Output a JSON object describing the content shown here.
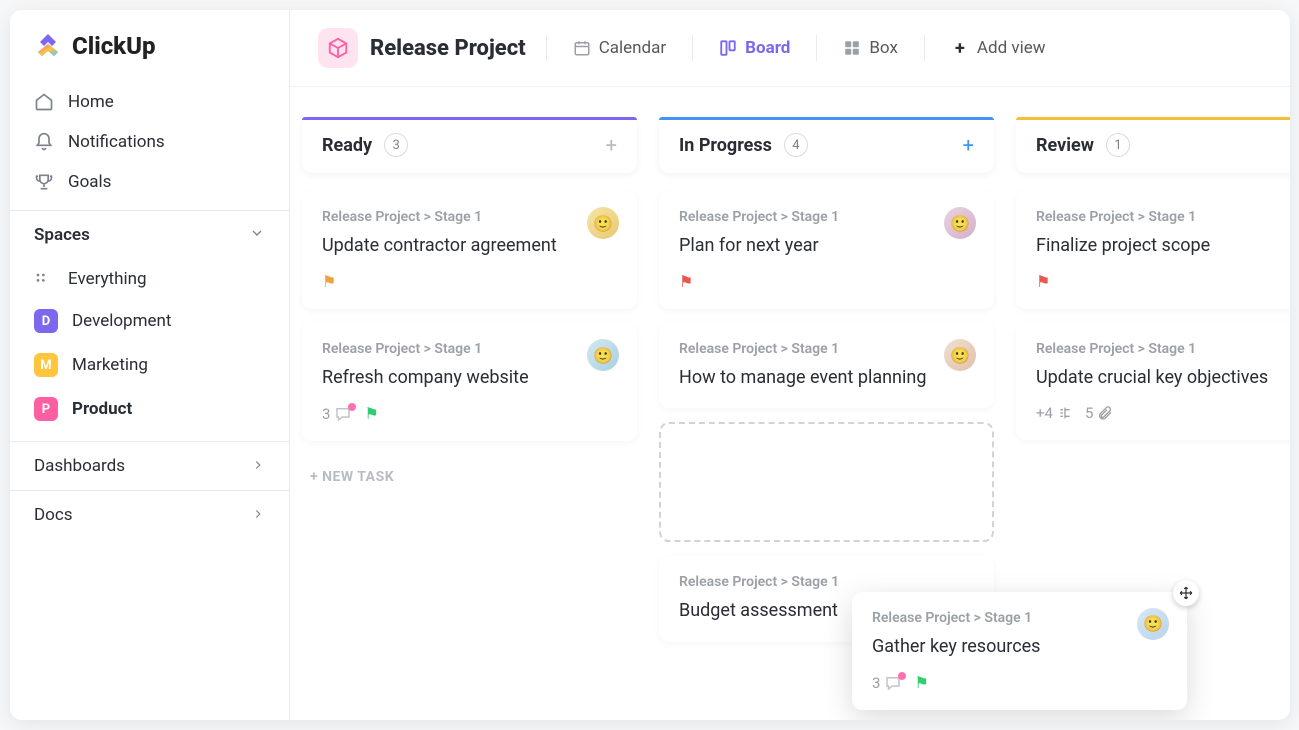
{
  "app_name": "ClickUp",
  "sidebar": {
    "nav": [
      {
        "icon": "home",
        "label": "Home"
      },
      {
        "icon": "bell",
        "label": "Notifications"
      },
      {
        "icon": "trophy",
        "label": "Goals"
      }
    ],
    "spaces_title": "Spaces",
    "everything_label": "Everything",
    "spaces": [
      {
        "letter": "D",
        "color": "#7b68ee",
        "label": "Development",
        "active": false
      },
      {
        "letter": "M",
        "color": "#ffc53d",
        "label": "Marketing",
        "active": false
      },
      {
        "letter": "P",
        "color": "#fd5fa3",
        "label": "Product",
        "active": true
      }
    ],
    "bottom": [
      {
        "label": "Dashboards"
      },
      {
        "label": "Docs"
      }
    ]
  },
  "header": {
    "project_title": "Release Project",
    "views": [
      {
        "icon": "calendar",
        "label": "Calendar",
        "active": false
      },
      {
        "icon": "board",
        "label": "Board",
        "active": true
      },
      {
        "icon": "box",
        "label": "Box",
        "active": false
      }
    ],
    "add_view_label": "Add view"
  },
  "board": {
    "breadcrumb": "Release Project > Stage 1",
    "new_task_label": "+ NEW TASK",
    "columns": [
      {
        "id": "ready",
        "title": "Ready",
        "count": "3",
        "add_color": "gray",
        "cards": [
          {
            "title": "Update contractor agreement",
            "avatar": "a",
            "flag": "orange"
          },
          {
            "title": "Refresh company website",
            "avatar": "c",
            "comments": "3",
            "flag": "green"
          }
        ]
      },
      {
        "id": "progress",
        "title": "In Progress",
        "count": "4",
        "add_color": "blue",
        "cards": [
          {
            "title": "Plan for next year",
            "avatar": "b",
            "flag": "red"
          },
          {
            "title": "How to manage event planning",
            "avatar": "d"
          }
        ],
        "has_dropzone": true,
        "extra_card": {
          "title": "Budget assessment"
        }
      },
      {
        "id": "review",
        "title": "Review",
        "count": "1",
        "cards": [
          {
            "title": "Finalize project scope",
            "flag": "red"
          },
          {
            "title": "Update crucial key objectives",
            "subtasks": "+4",
            "attachments": "5"
          }
        ]
      }
    ],
    "dragging": {
      "title": "Gather key resources",
      "avatar": "e",
      "comments": "3",
      "flag": "green"
    }
  }
}
